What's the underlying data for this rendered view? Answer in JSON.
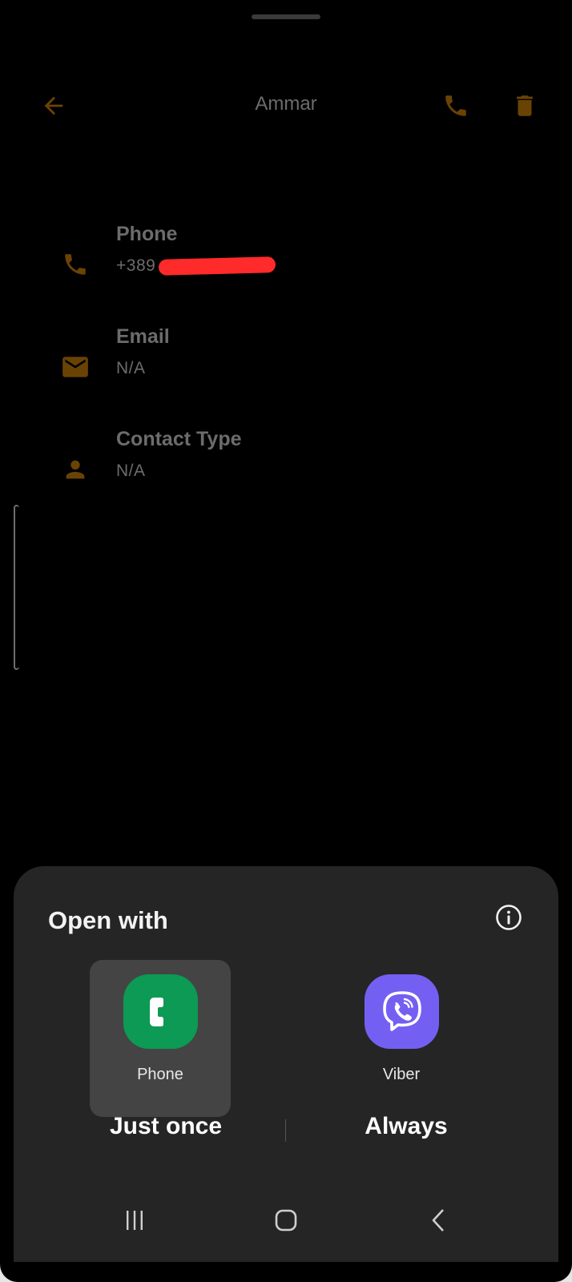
{
  "colors": {
    "accent_dim": "#6a4304",
    "background": "#000000",
    "sheet": "#252525",
    "selected_tile": "#444444",
    "phone_app": "#0c9a54",
    "viber_app": "#7360f2",
    "redaction": "#ff2a2a"
  },
  "toolbar": {
    "title": "Ammar",
    "back_icon": "arrow-back-icon",
    "call_icon": "phone-icon",
    "delete_icon": "trash-icon"
  },
  "details": [
    {
      "icon": "phone-icon",
      "label": "Phone",
      "value": "+389"
    },
    {
      "icon": "email-icon",
      "label": "Email",
      "value": "N/A"
    },
    {
      "icon": "person-icon",
      "label": "Contact Type",
      "value": "N/A"
    }
  ],
  "sheet": {
    "title": "Open with",
    "info_icon": "info-icon",
    "apps": [
      {
        "name": "Phone",
        "icon": "phone-app-icon",
        "selected": true
      },
      {
        "name": "Viber",
        "icon": "viber-app-icon",
        "selected": false
      }
    ],
    "just_once_label": "Just once",
    "always_label": "Always"
  },
  "navbar": {
    "recents_icon": "recents-icon",
    "home_icon": "home-icon",
    "back_icon": "nav-back-icon"
  }
}
